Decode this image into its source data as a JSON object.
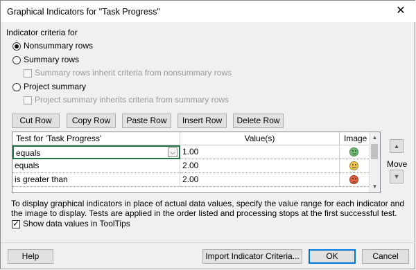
{
  "window": {
    "title": "Graphical Indicators for \"Task Progress\"",
    "close_icon": "close-icon"
  },
  "criteria": {
    "group_label": "Indicator criteria for",
    "nonsummary_label": "Nonsummary rows",
    "nonsummary_checked": true,
    "summary_label": "Summary rows",
    "summary_inherit_label": "Summary rows inherit criteria from nonsummary rows",
    "project_summary_label": "Project summary",
    "project_inherit_label": "Project summary inherits criteria from summary rows"
  },
  "row_buttons": {
    "cut": "Cut Row",
    "copy": "Copy Row",
    "paste": "Paste Row",
    "insert": "Insert Row",
    "delete": "Delete Row"
  },
  "table": {
    "headers": {
      "test": "Test for 'Task Progress'",
      "values": "Value(s)",
      "image": "Image"
    },
    "rows": [
      {
        "test": "equals",
        "value": "1.00",
        "image": "green-smiley-icon",
        "selected": true
      },
      {
        "test": "equals",
        "value": "2.00",
        "image": "yellow-neutral-face-icon",
        "selected": false
      },
      {
        "test": "is greater than",
        "value": "2.00",
        "image": "red-sad-face-icon",
        "selected": false
      }
    ]
  },
  "move": {
    "label": "Move",
    "up_icon": "triangle-up-icon",
    "down_icon": "triangle-down-icon"
  },
  "description": "To display graphical indicators in place of actual data values, specify the value range for each indicator and the image to display.  Tests are applied in the order listed and processing stops at the first successful test.",
  "tooltips": {
    "label": "Show data values in ToolTips",
    "checked": true
  },
  "footer": {
    "help": "Help",
    "import": "Import Indicator Criteria...",
    "ok": "OK",
    "cancel": "Cancel"
  },
  "colors": {
    "face_green": "#6fbf73",
    "face_yellow": "#f2c94c",
    "face_red": "#e0603a",
    "selected_border": "#217346",
    "default_button_border": "#0078d7"
  }
}
